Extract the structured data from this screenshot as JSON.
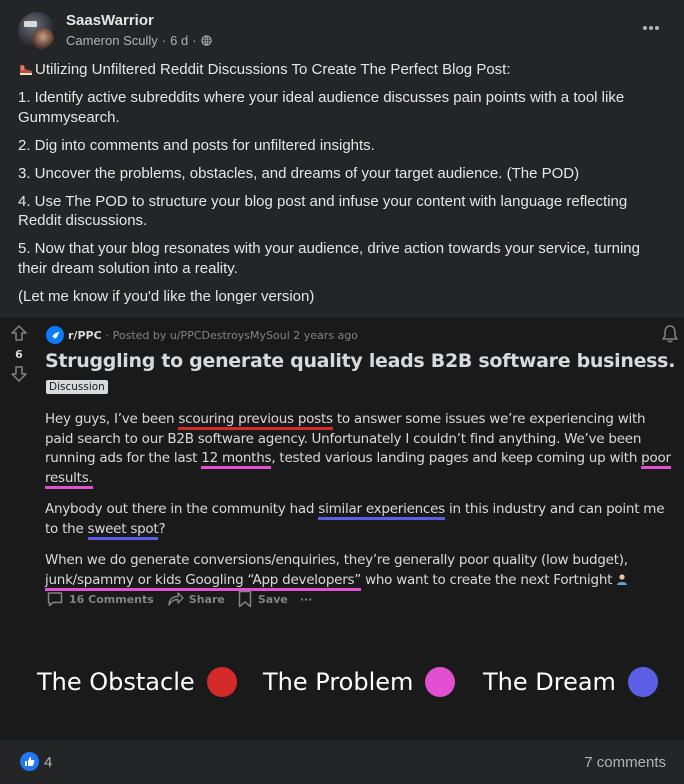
{
  "post": {
    "author": "SaasWarrior",
    "subauthor": "Cameron Scully",
    "time": "6 d",
    "lead": "Utilizing Unfiltered Reddit Discussions To Create The Perfect Blog Post:",
    "points": [
      "1. Identify active subreddits where your ideal audience discusses pain points with a tool like Gummysearch.",
      "2. Dig into comments and posts for unfiltered insights.",
      "3. Uncover the problems, obstacles, and dreams of your target audience. (The POD)",
      "4. Use The POD to structure your blog post and infuse your content with language reflecting Reddit discussions.",
      "5. Now that your blog resonates with your audience, drive action towards your service, turning their dream solution into a reality.",
      "(Let me know if you'd like the longer version)"
    ]
  },
  "reddit": {
    "votes": "6",
    "subreddit": "r/PPC",
    "posted_by": "· Posted by u/PPCDestroysMySoul 2 years ago",
    "title": "Struggling to generate quality leads B2B software business.",
    "flair": "Discussion",
    "p1": {
      "a": "Hey guys, I’ve been ",
      "b": "scouring previous posts",
      "c": " to answer some issues we’re experiencing with paid search to our B2B software agency. Unfortunately I couldn’t find anything. We’ve been running ads for the last ",
      "d": "12 months",
      "e": ", tested various landing pages and keep coming up with ",
      "f": "poor results."
    },
    "p2": {
      "a": "Anybody out there in the community had ",
      "b": "similar experiences",
      "c": " in this industry and can point me to the ",
      "d": "sweet spot",
      "e": "?"
    },
    "p3": {
      "a": "When we do generate conversions/enquiries, they’re generally poor quality (low budget), ",
      "b": "junk/spammy or kids Googling “App developers”",
      "c": " who want to create the next Fortnight "
    },
    "actions": {
      "comments": "16 Comments",
      "share": "Share",
      "save": "Save",
      "more": "···"
    }
  },
  "legend": [
    {
      "label": "The Obstacle",
      "color": "#d42a2a"
    },
    {
      "label": "The Problem",
      "color": "#e24fd0"
    },
    {
      "label": "The Dream",
      "color": "#5d5ee6"
    }
  ],
  "footer": {
    "likes": "4",
    "comments": "7 comments"
  },
  "icons": [
    "globe-icon",
    "more-icon",
    "shoe-icon",
    "upvote-icon",
    "downvote-icon",
    "rocket-icon",
    "bell-icon",
    "comment-icon",
    "share-icon",
    "bookmark-icon",
    "person-icon",
    "like-icon"
  ]
}
